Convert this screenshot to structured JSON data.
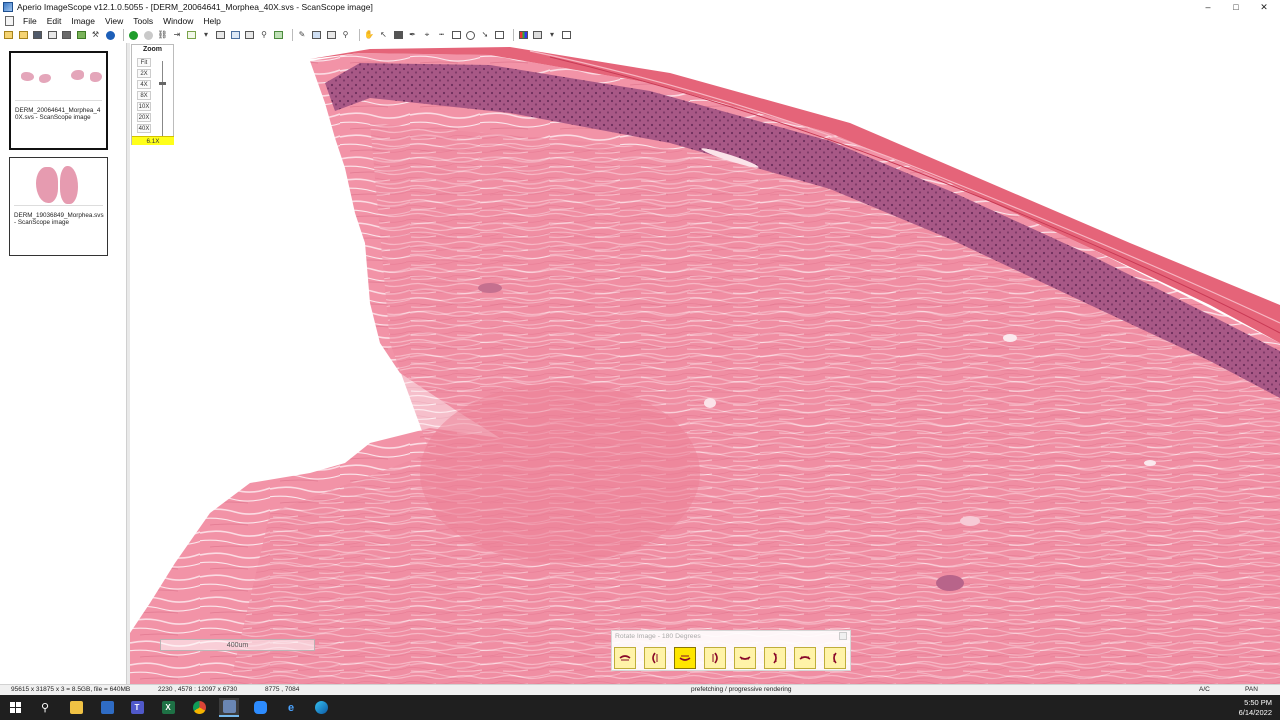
{
  "window": {
    "title": "Aperio ImageScope v12.1.0.5055 - [DERM_20064641_Morphea_40X.svs - ScanScope image]",
    "controls": [
      "–",
      "□",
      "✕"
    ]
  },
  "menu": {
    "items": [
      "File",
      "Edit",
      "Image",
      "View",
      "Tools",
      "Window",
      "Help"
    ]
  },
  "thumbnails": [
    {
      "caption": "DERM_20064641_Morphea_40X.svs - ScanScope image",
      "selected": true
    },
    {
      "caption": "DERM_19036849_Morphea.svs - ScanScope image",
      "selected": false
    }
  ],
  "zoom": {
    "title": "Zoom",
    "levels": [
      "Fit",
      "2X",
      "4X",
      "8X",
      "10X",
      "20X",
      "40X"
    ],
    "current": "6.1X"
  },
  "scalebar": {
    "label": "400um"
  },
  "rotate_panel": {
    "title": "Rotate Image - 180 Degrees",
    "buttons": [
      "rotate-0",
      "rotate-90",
      "rotate-180",
      "rotate-270",
      "flip-h",
      "flip-v",
      "flip-h-180",
      "flip-v-180"
    ],
    "active_index": 2
  },
  "status": {
    "dims": "95615 x 31875 x 3 = 8.5GB, file = 640MB",
    "view_coords": "2230 , 4578 : 12097 x 6730",
    "cursor": "8775 , 7084",
    "message": "prefetching / progressive rendering",
    "mode1": "A/C",
    "mode2": "PAN"
  },
  "taskbar": {
    "time": "5:50 PM",
    "date": "6/14/2022",
    "apps": [
      "windows-start",
      "search",
      "file-explorer",
      "defender",
      "teams",
      "excel",
      "chrome",
      "imagescope",
      "zoom",
      "edge-legacy",
      "edge"
    ]
  },
  "colors": {
    "tissue": "#f08ca0",
    "tissue_dark": "#e4708a",
    "epidermis": "#9a4a78",
    "zoom_highlight": "#ffff1a",
    "rotate_active": "#ffe600",
    "taskbar_bg": "#1f1f1f"
  }
}
